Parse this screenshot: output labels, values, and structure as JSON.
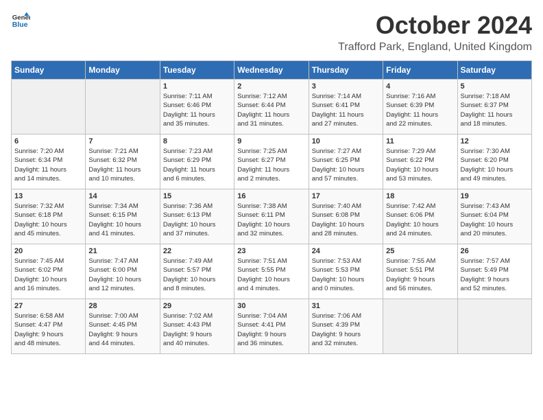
{
  "header": {
    "logo_line1": "General",
    "logo_line2": "Blue",
    "month_title": "October 2024",
    "location": "Trafford Park, England, United Kingdom"
  },
  "days_of_week": [
    "Sunday",
    "Monday",
    "Tuesday",
    "Wednesday",
    "Thursday",
    "Friday",
    "Saturday"
  ],
  "weeks": [
    [
      {
        "day": "",
        "content": ""
      },
      {
        "day": "",
        "content": ""
      },
      {
        "day": "1",
        "content": "Sunrise: 7:11 AM\nSunset: 6:46 PM\nDaylight: 11 hours\nand 35 minutes."
      },
      {
        "day": "2",
        "content": "Sunrise: 7:12 AM\nSunset: 6:44 PM\nDaylight: 11 hours\nand 31 minutes."
      },
      {
        "day": "3",
        "content": "Sunrise: 7:14 AM\nSunset: 6:41 PM\nDaylight: 11 hours\nand 27 minutes."
      },
      {
        "day": "4",
        "content": "Sunrise: 7:16 AM\nSunset: 6:39 PM\nDaylight: 11 hours\nand 22 minutes."
      },
      {
        "day": "5",
        "content": "Sunrise: 7:18 AM\nSunset: 6:37 PM\nDaylight: 11 hours\nand 18 minutes."
      }
    ],
    [
      {
        "day": "6",
        "content": "Sunrise: 7:20 AM\nSunset: 6:34 PM\nDaylight: 11 hours\nand 14 minutes."
      },
      {
        "day": "7",
        "content": "Sunrise: 7:21 AM\nSunset: 6:32 PM\nDaylight: 11 hours\nand 10 minutes."
      },
      {
        "day": "8",
        "content": "Sunrise: 7:23 AM\nSunset: 6:29 PM\nDaylight: 11 hours\nand 6 minutes."
      },
      {
        "day": "9",
        "content": "Sunrise: 7:25 AM\nSunset: 6:27 PM\nDaylight: 11 hours\nand 2 minutes."
      },
      {
        "day": "10",
        "content": "Sunrise: 7:27 AM\nSunset: 6:25 PM\nDaylight: 10 hours\nand 57 minutes."
      },
      {
        "day": "11",
        "content": "Sunrise: 7:29 AM\nSunset: 6:22 PM\nDaylight: 10 hours\nand 53 minutes."
      },
      {
        "day": "12",
        "content": "Sunrise: 7:30 AM\nSunset: 6:20 PM\nDaylight: 10 hours\nand 49 minutes."
      }
    ],
    [
      {
        "day": "13",
        "content": "Sunrise: 7:32 AM\nSunset: 6:18 PM\nDaylight: 10 hours\nand 45 minutes."
      },
      {
        "day": "14",
        "content": "Sunrise: 7:34 AM\nSunset: 6:15 PM\nDaylight: 10 hours\nand 41 minutes."
      },
      {
        "day": "15",
        "content": "Sunrise: 7:36 AM\nSunset: 6:13 PM\nDaylight: 10 hours\nand 37 minutes."
      },
      {
        "day": "16",
        "content": "Sunrise: 7:38 AM\nSunset: 6:11 PM\nDaylight: 10 hours\nand 32 minutes."
      },
      {
        "day": "17",
        "content": "Sunrise: 7:40 AM\nSunset: 6:08 PM\nDaylight: 10 hours\nand 28 minutes."
      },
      {
        "day": "18",
        "content": "Sunrise: 7:42 AM\nSunset: 6:06 PM\nDaylight: 10 hours\nand 24 minutes."
      },
      {
        "day": "19",
        "content": "Sunrise: 7:43 AM\nSunset: 6:04 PM\nDaylight: 10 hours\nand 20 minutes."
      }
    ],
    [
      {
        "day": "20",
        "content": "Sunrise: 7:45 AM\nSunset: 6:02 PM\nDaylight: 10 hours\nand 16 minutes."
      },
      {
        "day": "21",
        "content": "Sunrise: 7:47 AM\nSunset: 6:00 PM\nDaylight: 10 hours\nand 12 minutes."
      },
      {
        "day": "22",
        "content": "Sunrise: 7:49 AM\nSunset: 5:57 PM\nDaylight: 10 hours\nand 8 minutes."
      },
      {
        "day": "23",
        "content": "Sunrise: 7:51 AM\nSunset: 5:55 PM\nDaylight: 10 hours\nand 4 minutes."
      },
      {
        "day": "24",
        "content": "Sunrise: 7:53 AM\nSunset: 5:53 PM\nDaylight: 10 hours\nand 0 minutes."
      },
      {
        "day": "25",
        "content": "Sunrise: 7:55 AM\nSunset: 5:51 PM\nDaylight: 9 hours\nand 56 minutes."
      },
      {
        "day": "26",
        "content": "Sunrise: 7:57 AM\nSunset: 5:49 PM\nDaylight: 9 hours\nand 52 minutes."
      }
    ],
    [
      {
        "day": "27",
        "content": "Sunrise: 6:58 AM\nSunset: 4:47 PM\nDaylight: 9 hours\nand 48 minutes."
      },
      {
        "day": "28",
        "content": "Sunrise: 7:00 AM\nSunset: 4:45 PM\nDaylight: 9 hours\nand 44 minutes."
      },
      {
        "day": "29",
        "content": "Sunrise: 7:02 AM\nSunset: 4:43 PM\nDaylight: 9 hours\nand 40 minutes."
      },
      {
        "day": "30",
        "content": "Sunrise: 7:04 AM\nSunset: 4:41 PM\nDaylight: 9 hours\nand 36 minutes."
      },
      {
        "day": "31",
        "content": "Sunrise: 7:06 AM\nSunset: 4:39 PM\nDaylight: 9 hours\nand 32 minutes."
      },
      {
        "day": "",
        "content": ""
      },
      {
        "day": "",
        "content": ""
      }
    ]
  ]
}
